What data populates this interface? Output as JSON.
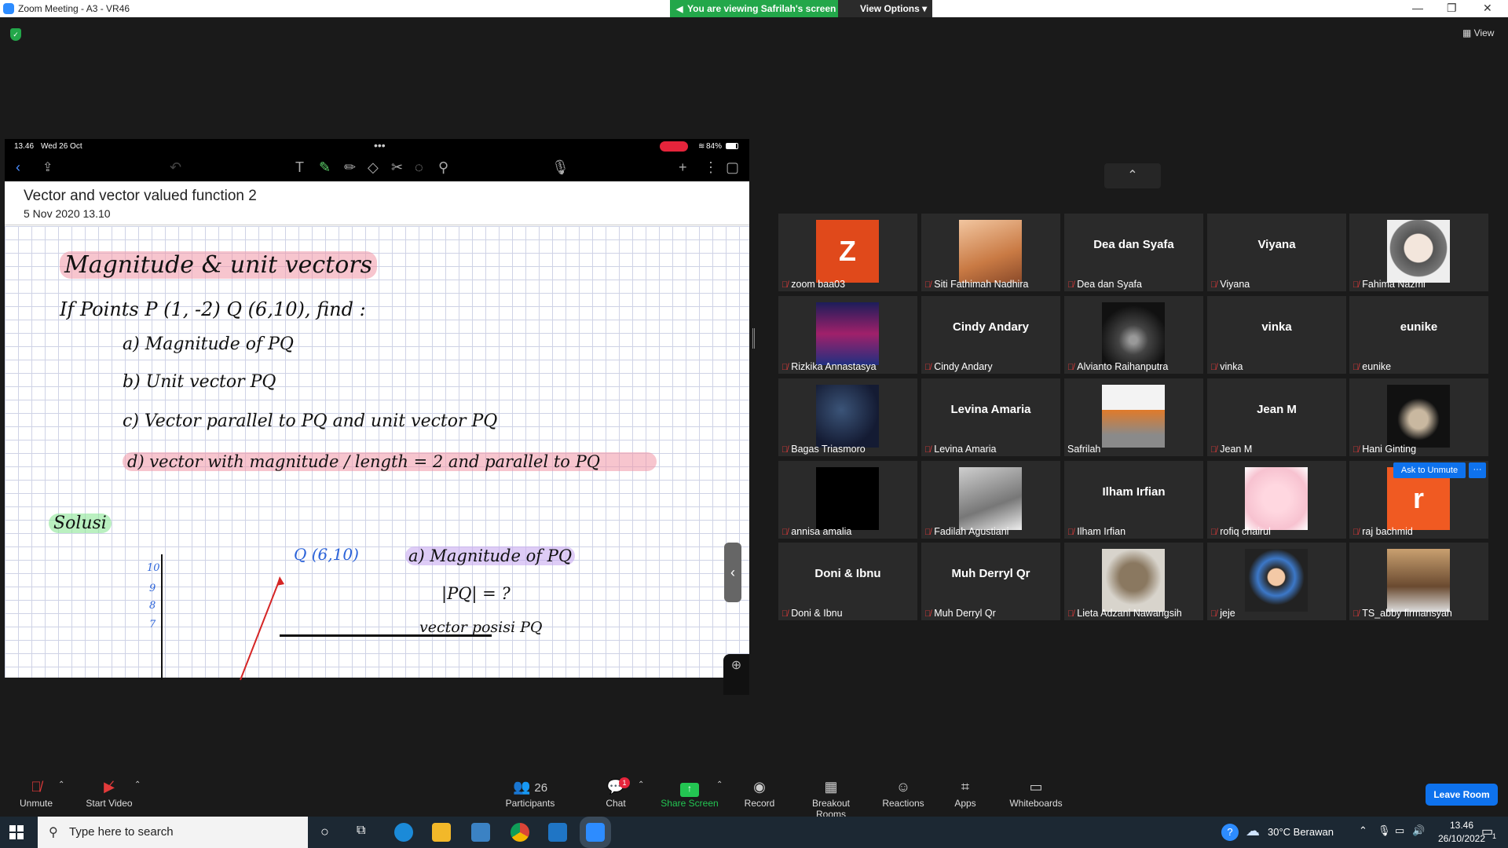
{
  "window": {
    "title": "Zoom Meeting - A3 - VR46",
    "viewing_banner": "You are viewing Safrilah's screen",
    "view_options": "View Options",
    "view_button": "View"
  },
  "colors": {
    "accent": "#0e72ed",
    "banner_green": "#23a74a",
    "muted_red": "#e23b3b"
  },
  "ipad": {
    "time": "13.46",
    "date": "Wed 26 Oct",
    "battery": "84%",
    "note_title": "Vector and vector valued function 2",
    "note_date": "5 Nov 2020 13.10",
    "handwriting": {
      "heading": "Magnitude & unit vectors",
      "problem": "If Points P (1, -2) Q (6,10), find :",
      "items": [
        "a) Magnitude of PQ",
        "b) Unit vector PQ",
        "c) Vector parallel to PQ and unit vector PQ",
        "d) vector with magnitude / length = 2 and parallel to PQ"
      ],
      "solusi": "Solusi",
      "point_q": "Q (6,10)",
      "answer_a": "a) Magnitude of PQ",
      "abs_pq": "|PQ| = ?",
      "vector_posisi": "vector posisi PQ",
      "y_ticks": [
        "10",
        "9",
        "8",
        "7"
      ]
    }
  },
  "participants": [
    {
      "name": "zoom baa03",
      "avatar": "Z",
      "color": "#e0491b"
    },
    {
      "name": "Siti Fathimah Nadhira",
      "photo": "anime-avatar"
    },
    {
      "name": "Dea dan Syafa",
      "big": "Dea dan Syafa"
    },
    {
      "name": "Viyana",
      "big": "Viyana"
    },
    {
      "name": "Fahima Nazmi",
      "photo": "hijab-cartoon"
    },
    {
      "name": "Rizkika Annastasya",
      "photo": "punk-poster"
    },
    {
      "name": "Cindy Andary",
      "big": "Cindy Andary"
    },
    {
      "name": "Alvianto Raihanputra",
      "photo": "corridor"
    },
    {
      "name": "vinka",
      "big": "vinka"
    },
    {
      "name": "eunike",
      "big": "eunike"
    },
    {
      "name": "Bagas Triasmoro",
      "photo": "galaxy"
    },
    {
      "name": "Levina Amaria",
      "big": "Levina Amaria"
    },
    {
      "name": "Safrilah",
      "photo": "buildings"
    },
    {
      "name": "Jean M",
      "big": "Jean M"
    },
    {
      "name": "Hani Ginting",
      "photo": "jar"
    },
    {
      "name": "annisa amalia",
      "photo": "black"
    },
    {
      "name": "Fadilah Agustiani",
      "photo": "hand"
    },
    {
      "name": "Ilham Irfian",
      "big": "Ilham Irfian"
    },
    {
      "name": "rofiq chairul",
      "photo": "blur-pink"
    },
    {
      "name": "raj bachmid",
      "avatar": "r",
      "color": "#f05a22"
    },
    {
      "name": "Doni & Ibnu",
      "big": "Doni & Ibnu"
    },
    {
      "name": "Muh Derryl Qr",
      "big": "Muh Derryl Qr"
    },
    {
      "name": "Lieta Adzani Nawangsih",
      "photo": "statue"
    },
    {
      "name": "jeje",
      "photo": "cartoon-girl"
    },
    {
      "name": "TS_abby firmansyah",
      "photo": "selfie"
    }
  ],
  "ask_to_unmute": "Ask to Unmute",
  "toolbar": {
    "unmute": "Unmute",
    "start_video": "Start Video",
    "participants": "Participants",
    "participants_count": "26",
    "chat": "Chat",
    "chat_badge": "1",
    "share_screen": "Share Screen",
    "record": "Record",
    "breakout_rooms": "Breakout Rooms",
    "reactions": "Reactions",
    "apps": "Apps",
    "whiteboards": "Whiteboards",
    "leave": "Leave Room"
  },
  "taskbar": {
    "search_placeholder": "Type here to search",
    "weather": "30°C  Berawan",
    "time": "13.46",
    "date": "26/10/2022",
    "notif_count": "1"
  }
}
